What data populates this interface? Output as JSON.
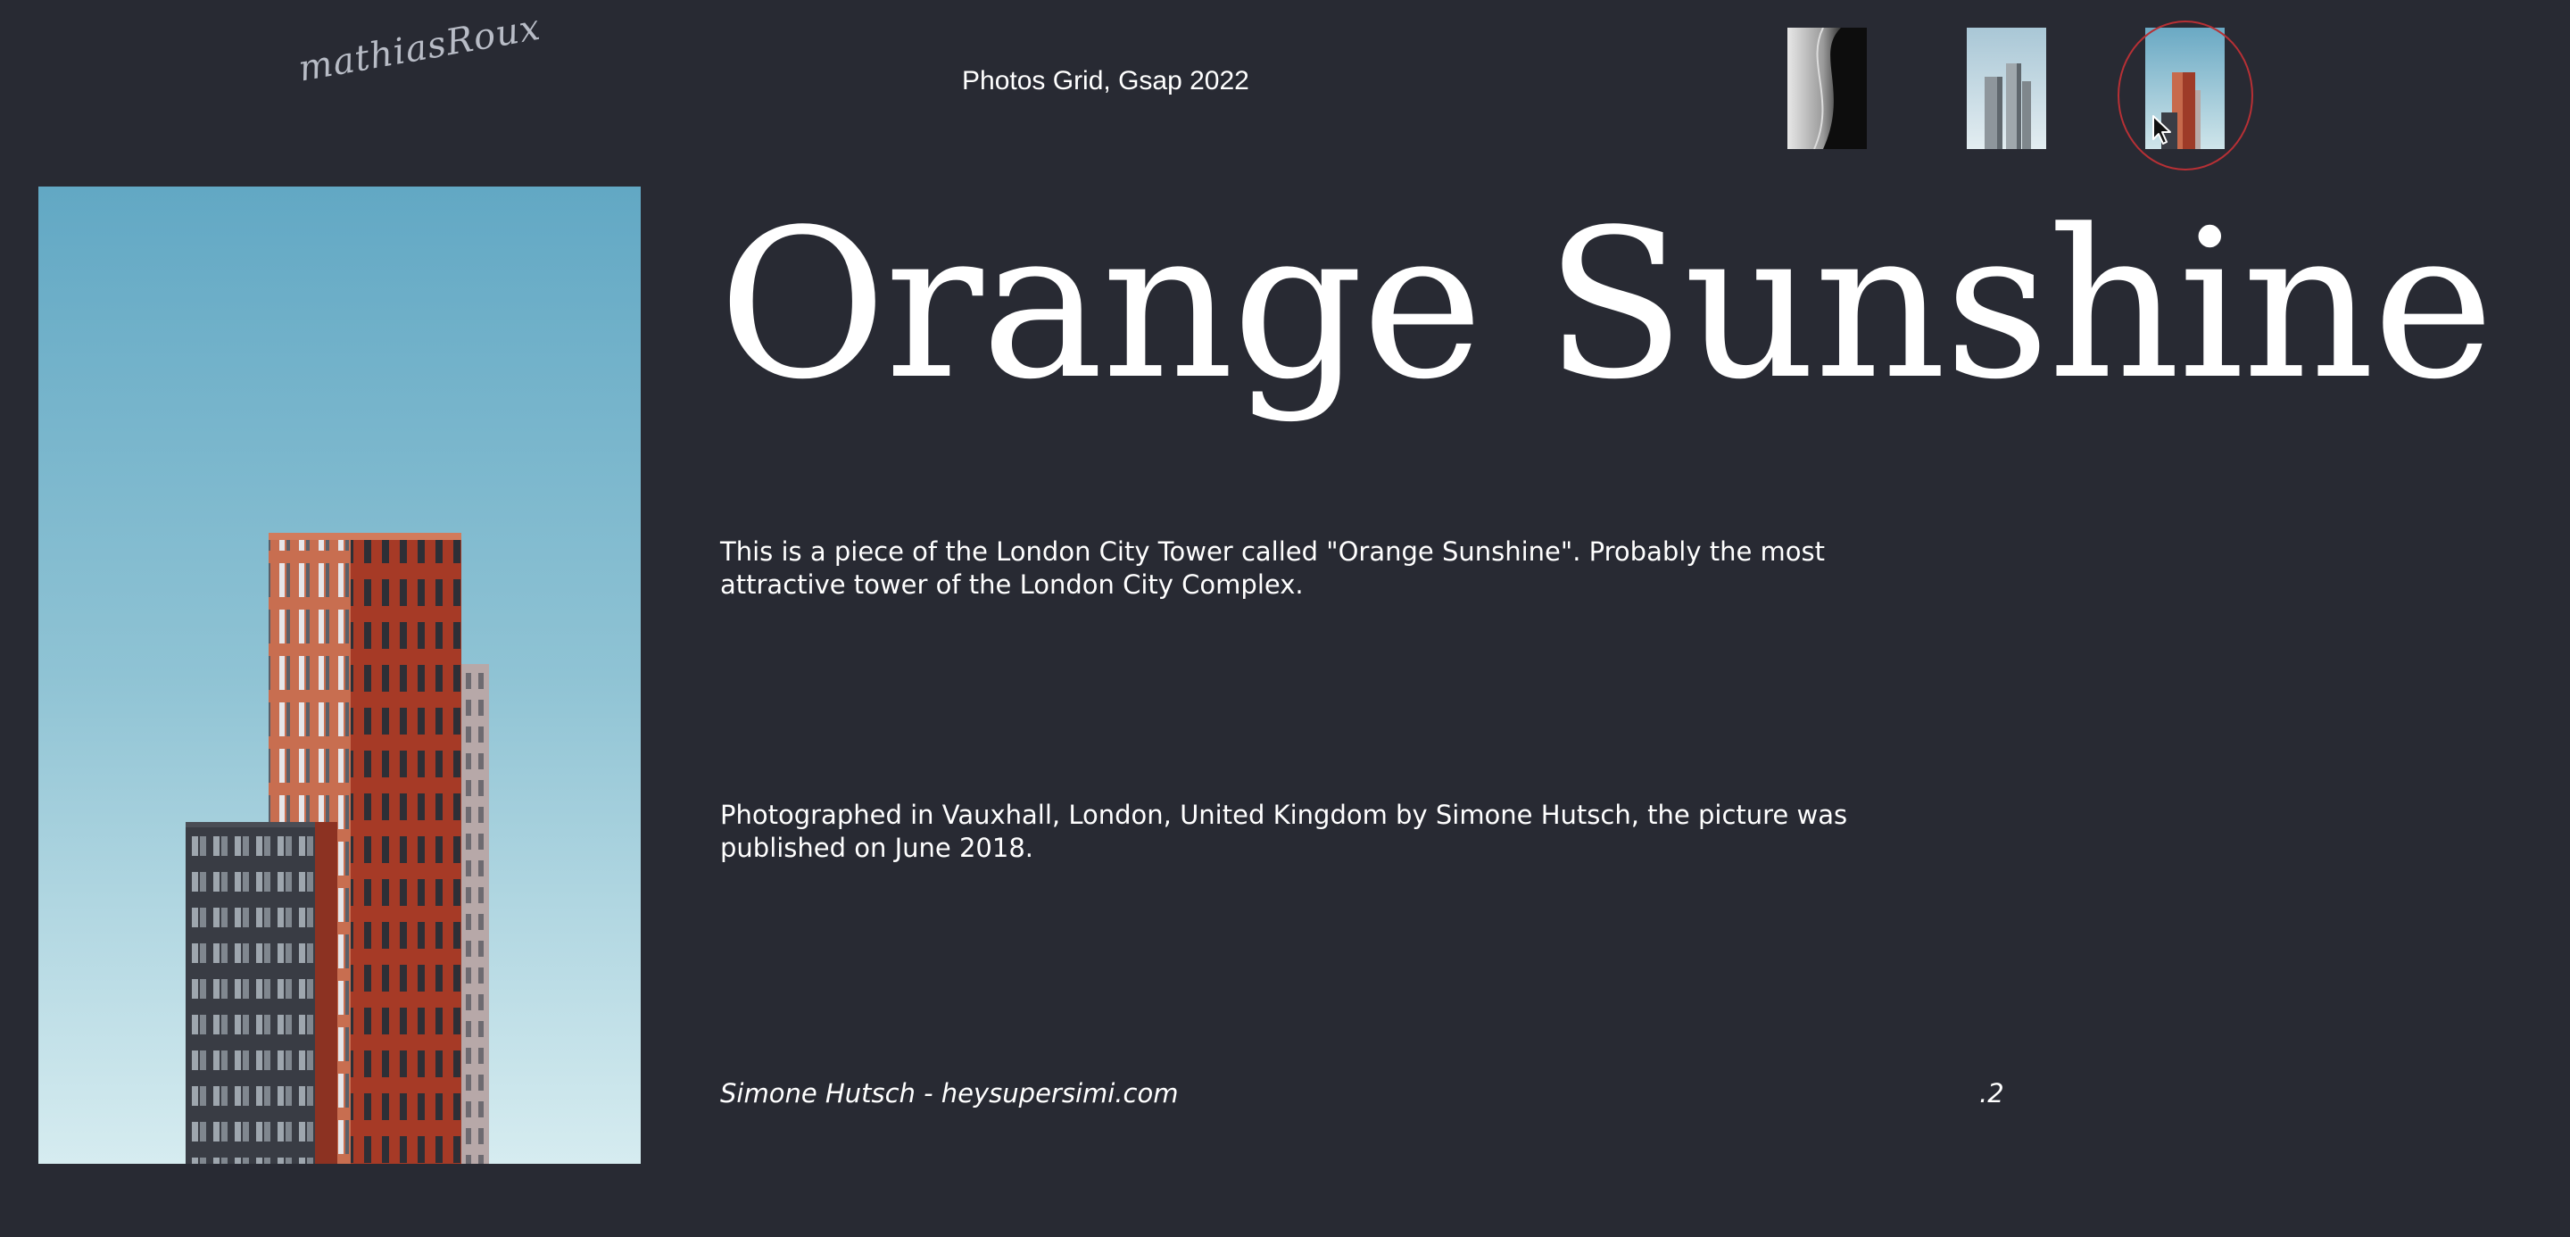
{
  "header": {
    "logo_text": "mathiasRoux",
    "title": "Photos Grid, Gsap 2022"
  },
  "thumbnails": [
    {
      "name": "black-white-curve-building",
      "selected": false
    },
    {
      "name": "twin-grey-towers",
      "selected": false
    },
    {
      "name": "orange-sunshine-tower",
      "selected": true
    }
  ],
  "main": {
    "title": "Orange Sunshine",
    "paragraph_1": "This is a piece of the London City Tower called \"Orange Sunshine\". Probably the most attractive tower of the London City Complex.",
    "paragraph_2": "Photographed in Vauxhall, London, United Kingdom by Simone Hutsch, the picture was published on June 2018.",
    "credit": "Simone Hutsch - heysupersimi.com",
    "page_number": ".2"
  },
  "colors": {
    "background": "#282a33",
    "text": "#ffffff",
    "selection_ring": "#b73035",
    "sky_top": "#64a8c4",
    "sky_bottom": "#d4eaee",
    "tower_orange": "#c1583d"
  }
}
